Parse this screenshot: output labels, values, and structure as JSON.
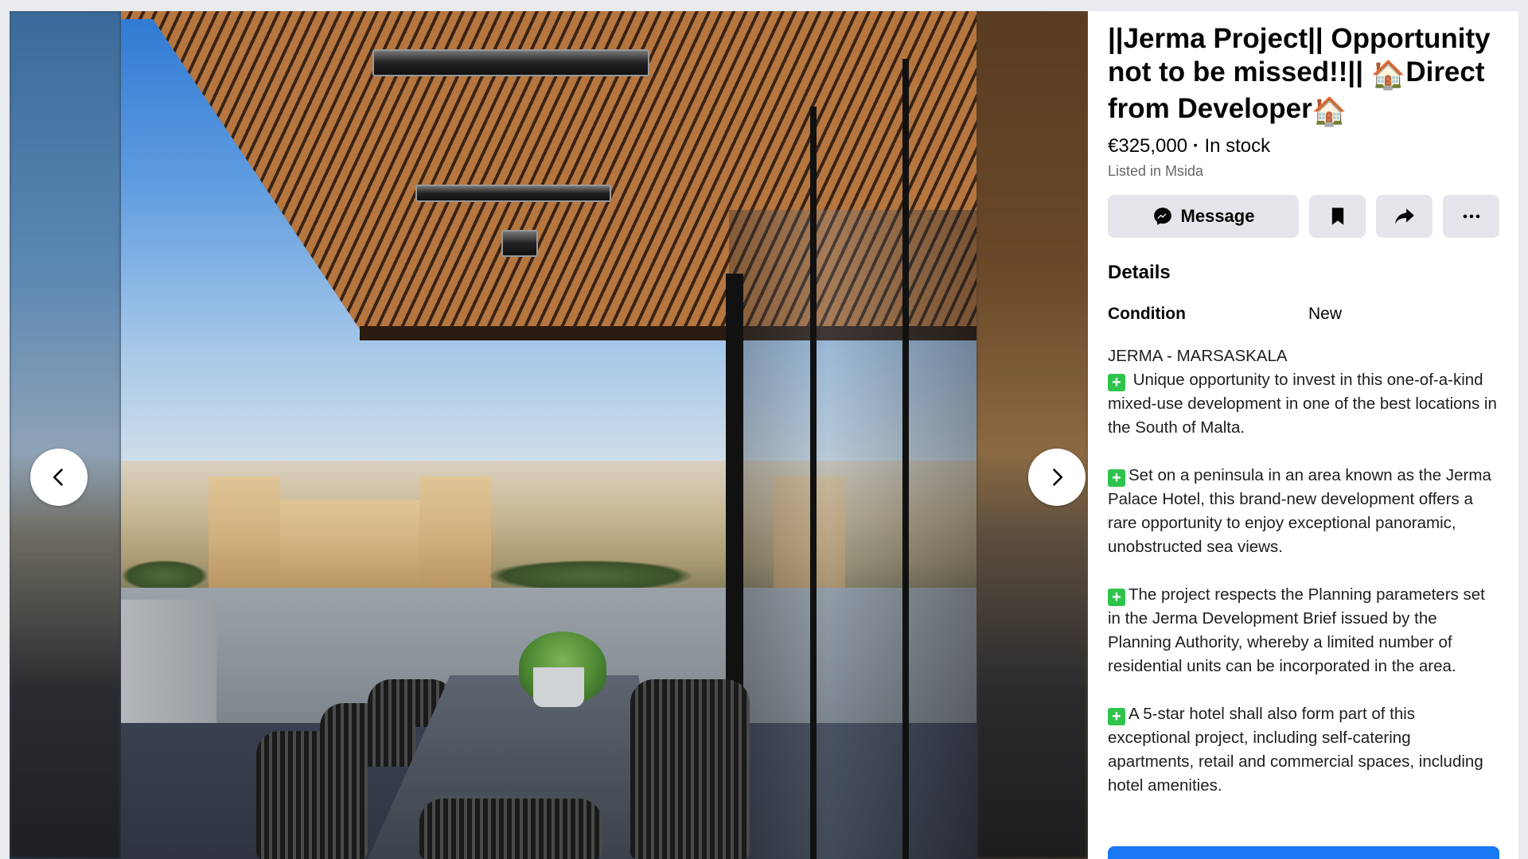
{
  "listing": {
    "title": "||Jerma Project|| Opportunity not to be missed!!||",
    "title_emoji_1": "🏠",
    "title_mid": "Direct from Developer",
    "title_emoji_2": "🏠",
    "price": "€325,000",
    "availability": "In stock",
    "separator": " · ",
    "location": "Listed in Msida"
  },
  "actions": {
    "message_label": "Message",
    "message_icon": "messenger-icon",
    "save_icon": "bookmark-icon",
    "share_icon": "share-arrow-icon",
    "more_icon": "more-dots-icon"
  },
  "details": {
    "heading": "Details",
    "condition_label": "Condition",
    "condition_value": "New"
  },
  "description": {
    "headline": "JERMA - MARSASKALA",
    "check_glyph": "+",
    "paragraphs": [
      "Unique opportunity to invest in this one-of-a-kind mixed-use development in one of the best locations in the South of Malta.",
      "Set on a peninsula in an area known as the Jerma Palace Hotel, this brand-new development offers a rare opportunity to enjoy exceptional panoramic, unobstructed sea views.",
      "The project respects the Planning parameters set in the Jerma Development Brief issued by the Planning Authority, whereby a limited number of residential units can be incorporated in the area.",
      "A 5-star hotel shall also form part of this exceptional project, including self-catering apartments, retail and commercial spaces, including hotel amenities."
    ]
  },
  "viewer": {
    "prev_icon": "chevron-left-icon",
    "next_icon": "chevron-right-icon"
  },
  "colors": {
    "accent": "#1877f2",
    "button_bg": "#e4e6eb",
    "check_green": "#2ec44b",
    "secondary_text": "#65676b"
  }
}
